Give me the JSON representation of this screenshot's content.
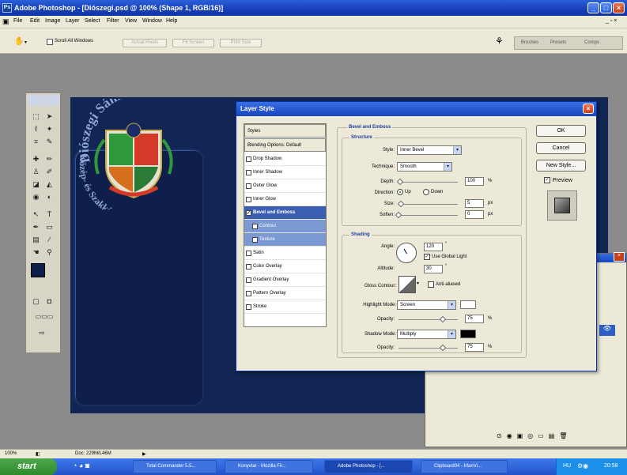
{
  "window": {
    "title": "Adobe Photoshop - [Diószegi.psd @ 100% (Shape 1, RGB/16)]"
  },
  "menu": [
    "File",
    "Edit",
    "Image",
    "Layer",
    "Select",
    "Filter",
    "View",
    "Window",
    "Help"
  ],
  "options": {
    "scroll_all": "Scroll All Windows",
    "actual_pixels": "Actual Pixels",
    "fit_screen": "Fit Screen",
    "print_size": "Print Size"
  },
  "palette_well": [
    "Brushes",
    "Presets",
    "Comps"
  ],
  "document": {
    "logo_top_text": "Diószegi Sámuel",
    "logo_bottom_text": "Közép- és Szakképző Iskola"
  },
  "dialog": {
    "title": "Layer Style",
    "styles_header": "Styles",
    "blending_options": "Blending Options: Default",
    "items": [
      {
        "label": "Drop Shadow",
        "checked": false
      },
      {
        "label": "Inner Shadow",
        "checked": false
      },
      {
        "label": "Outer Glow",
        "checked": false
      },
      {
        "label": "Inner Glow",
        "checked": false
      },
      {
        "label": "Bevel and Emboss",
        "checked": true
      },
      {
        "label": "Contour",
        "checked": false
      },
      {
        "label": "Texture",
        "checked": false
      },
      {
        "label": "Satin",
        "checked": false
      },
      {
        "label": "Color Overlay",
        "checked": false
      },
      {
        "label": "Gradient Overlay",
        "checked": false
      },
      {
        "label": "Pattern Overlay",
        "checked": false
      },
      {
        "label": "Stroke",
        "checked": false
      }
    ],
    "section_title": "Bevel and Emboss",
    "structure": {
      "label": "Structure",
      "style_label": "Style:",
      "style_value": "Inner Bevel",
      "technique_label": "Technique:",
      "technique_value": "Smooth",
      "depth_label": "Depth:",
      "depth_value": "100",
      "depth_unit": "%",
      "direction_label": "Direction:",
      "direction_up": "Up",
      "direction_down": "Down",
      "size_label": "Size:",
      "size_value": "5",
      "size_unit": "px",
      "soften_label": "Soften:",
      "soften_value": "0",
      "soften_unit": "px"
    },
    "shading": {
      "label": "Shading",
      "angle_label": "Angle:",
      "angle_value": "120",
      "angle_unit": "°",
      "global_light": "Use Global Light",
      "altitude_label": "Altitude:",
      "altitude_value": "30",
      "altitude_unit": "°",
      "gloss_label": "Gloss Contour:",
      "anti_aliased": "Anti-aliased",
      "highlight_label": "Highlight Mode:",
      "highlight_value": "Screen",
      "highlight_color": "#ffffff",
      "h_opacity_label": "Opacity:",
      "h_opacity_value": "75",
      "h_opacity_unit": "%",
      "shadow_label": "Shadow Mode:",
      "shadow_value": "Multiply",
      "shadow_color": "#000000",
      "s_opacity_label": "Opacity:",
      "s_opacity_value": "75",
      "s_opacity_unit": "%"
    },
    "buttons": {
      "ok": "OK",
      "cancel": "Cancel",
      "new_style": "New Style...",
      "preview": "Preview"
    }
  },
  "status": {
    "zoom": "100%",
    "doc": "Doc: 229M/L46M"
  },
  "taskbar": {
    "start": "start",
    "tasks": [
      "Total Commander 5.5...",
      "Konyvtar - Mozilla Fir...",
      "Adobe Photoshop - [...",
      "Clipboard04 - IrfanVi..."
    ],
    "lang": "HU",
    "clock": "20:58"
  },
  "colors": {
    "doc_bg": "#112654",
    "accent": "#1746c0"
  }
}
